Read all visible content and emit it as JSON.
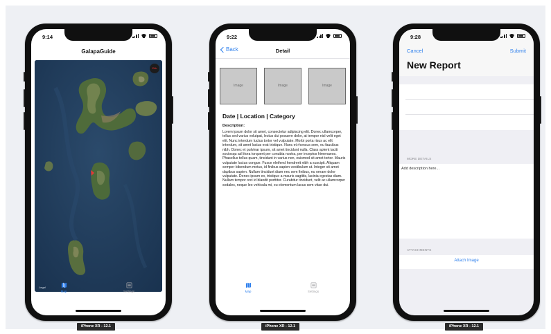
{
  "phones": [
    {
      "device_label": "iPhone XR - 12.1",
      "status_time": "9:14",
      "nav_title": "GalapaGuide",
      "map": {
        "badge": "Ekk",
        "credit": "Legal"
      },
      "tabs": [
        {
          "label": "Map",
          "icon": "map-icon",
          "active": true
        },
        {
          "label": "Settings",
          "icon": "settings-icon",
          "active": false
        }
      ]
    },
    {
      "device_label": "iPhone XR - 12.1",
      "status_time": "9:22",
      "back_label": "Back",
      "nav_title": "Detail",
      "images": [
        "Image",
        "Image",
        "Image"
      ],
      "heading": "Date | Location | Category",
      "description_label": "Description:",
      "description": "Lorem ipsum dolor sit amet, consectetur adipiscing elit. Donec ullamcorper, tellus sed varius volutpat, lectus dui posuere dolor, at tempor nisl velit eget elit. Nunc interdum luctus tortor vel vulputate. Morbi porta risus ac elit interdum, sit amet luctus erat tristique. Nunc et rhoncus sem, eu faucibus nibh. Donec et pulvinar ipsum, sit amet tincidunt nulla. Class aptent taciti sociosqu ad litora torquent per conubia nostra, per inceptos himenaeos. Phasellus tellus quam, tincidunt in varius non, euismod sit amet tortor. Mauris vulputate luctus congue. Fusce eleifend hendrerit nibh a suscipit. Aliquam semper bibendum metus, id finibus sapien vestibulum ut. Integer sit amet dapibus sapien. Nullam tincidunt diam nec sem finibus, eu ornare dolor vulputate. Donec ipsum ex, tristique a mauris sagittis, lacinia egestas diam. Nullam tempor orci id blandit porttitor. Curabitur tincidunt, velit ac ullamcorper sodales, neque leo vehicula mi, eu elementum lacus sem vitae dui.",
      "tabs": [
        {
          "label": "Map",
          "icon": "map-icon",
          "active": true
        },
        {
          "label": "Settings",
          "icon": "settings-icon",
          "active": false
        }
      ]
    },
    {
      "device_label": "iPhone XR - 12.1",
      "status_time": "9:28",
      "cancel_label": "Cancel",
      "submit_label": "Submit",
      "title": "New Report",
      "more_details_header": "MORE DETAILS",
      "description_placeholder": "Add description here...",
      "attachments_header": "ATTACHMENTS",
      "attach_button": "Attach Image"
    }
  ],
  "colors": {
    "accent": "#2f80ed",
    "tab_inactive": "#a4a4a8",
    "grouped_bg": "#efeff4"
  }
}
